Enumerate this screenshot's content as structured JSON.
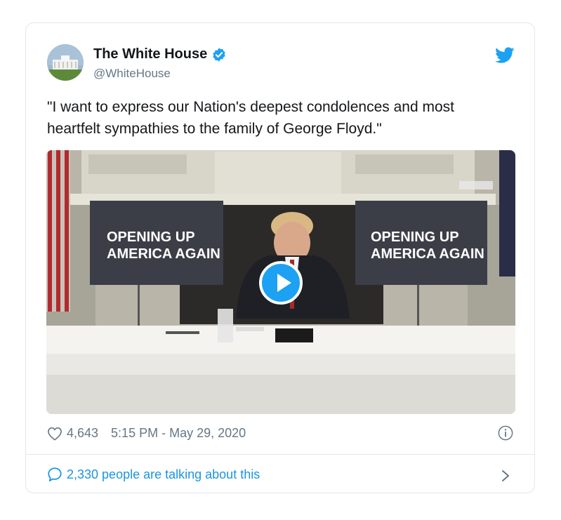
{
  "tweet": {
    "author_name": "The White House",
    "author_handle": "@WhiteHouse",
    "text": "\"I want to express our Nation's deepest condolences and most heartfelt sympathies to the family of George Floyd.\"",
    "likes": "4,643",
    "timestamp": "5:15 PM - May 29, 2020",
    "talking": "2,330 people are talking about this"
  },
  "media": {
    "sign_line1": "OPENING UP",
    "sign_line2": "AMERICA AGAIN"
  },
  "icons": {
    "verified": "verified-badge-icon",
    "brand": "twitter-bird-icon",
    "like": "heart-icon",
    "info": "info-icon",
    "talk": "speech-bubble-icon",
    "more": "chevron-right-icon",
    "play": "play-icon"
  },
  "colors": {
    "brand": "#1da1f2",
    "link": "#1b95e0",
    "muted": "#657786",
    "text": "#14171a"
  }
}
